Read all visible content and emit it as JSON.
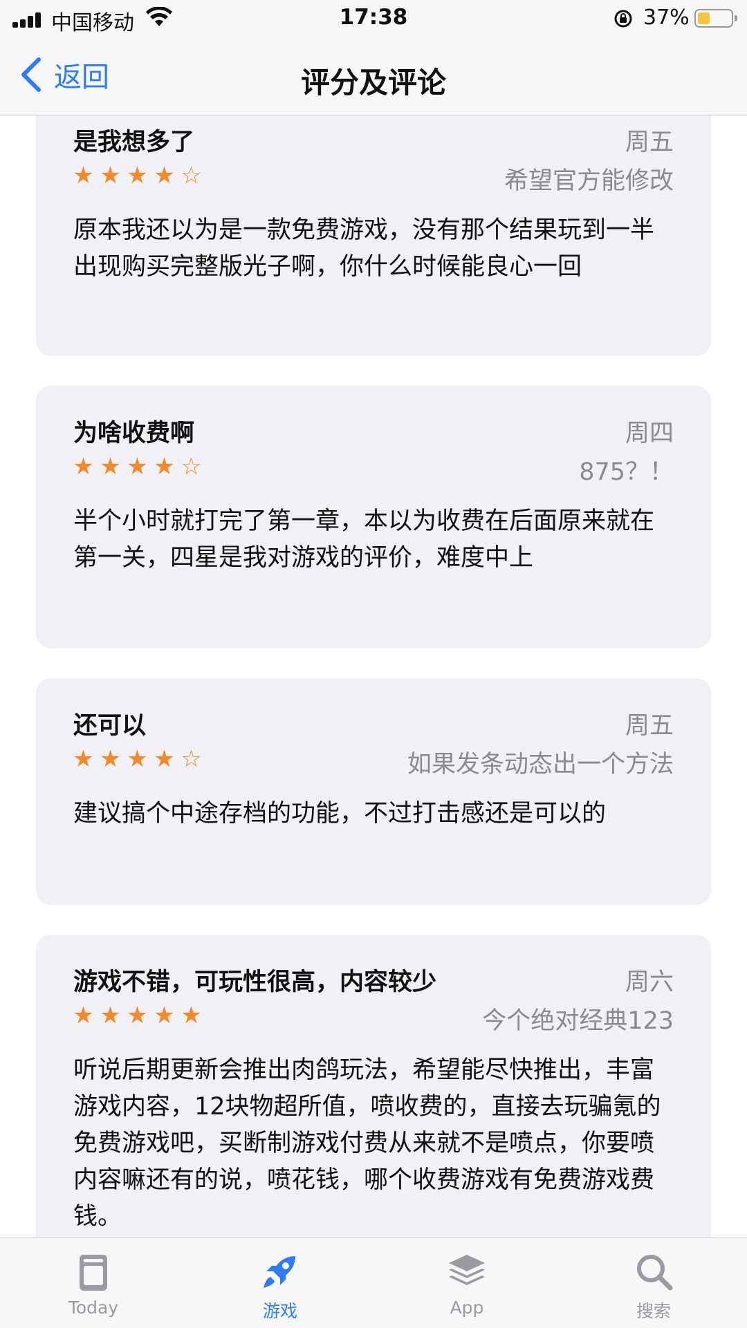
{
  "status_bar": {
    "carrier": "中国移动",
    "time": "17:38",
    "battery_percent": "37%",
    "battery_level": 0.37
  },
  "nav": {
    "back_label": "返回",
    "title": "评分及评论"
  },
  "reviews": [
    {
      "title": "是我想多了",
      "date": "周五",
      "rating": 4,
      "author": "希望官方能修改",
      "body": "原本我还以为是一款免费游戏，没有那个结果玩到一半出现购买完整版光子啊，你什么时候能良心一回"
    },
    {
      "title": "为啥收费啊",
      "date": "周四",
      "rating": 4,
      "author": "875？！",
      "body": "半个小时就打完了第一章，本以为收费在后面原来就在第一关，四星是我对游戏的评价，难度中上"
    },
    {
      "title": "还可以",
      "date": "周五",
      "rating": 4,
      "author": "如果发条动态出一个方法",
      "body": "建议搞个中途存档的功能，不过打击感还是可以的"
    },
    {
      "title": "游戏不错，可玩性很高，内容较少",
      "date": "周六",
      "rating": 5,
      "author": "今个绝对经典123",
      "body": "听说后期更新会推出肉鸽玩法，希望能尽快推出，丰富游戏内容，12块物超所值，喷收费的，直接去玩骗氪的免费游戏吧，买断制游戏付费从来就不是喷点，你要喷内容嘛还有的说，喷花钱，哪个收费游戏有免费游戏费钱。"
    }
  ],
  "tabs": [
    {
      "label": "Today",
      "icon": "today-icon",
      "active": false
    },
    {
      "label": "游戏",
      "icon": "rocket-icon",
      "active": true
    },
    {
      "label": "App",
      "icon": "app-stack-icon",
      "active": false
    },
    {
      "label": "搜索",
      "icon": "search-icon",
      "active": false
    }
  ],
  "colors": {
    "accent": "#2f7cf6",
    "star": "#f08a2c",
    "card_bg": "#f1f1f5",
    "secondary_text": "#8a8a8f"
  }
}
